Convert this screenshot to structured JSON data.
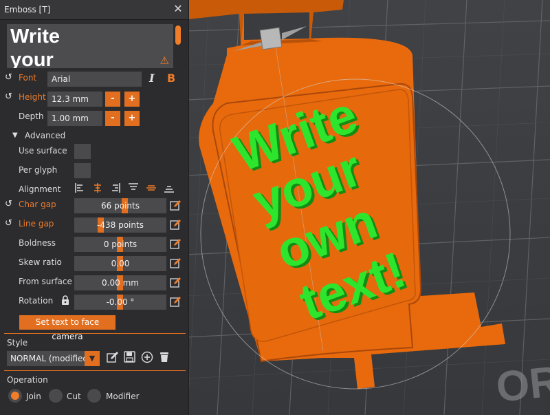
{
  "window": {
    "title": "Emboss [T]"
  },
  "text_editor": {
    "lines": [
      "Write",
      "your"
    ],
    "warning_icon": "warning-icon"
  },
  "font": {
    "label": "Font",
    "value": "Arial",
    "italic_icon": "italic-icon",
    "bold_label": "B"
  },
  "height": {
    "label": "Height",
    "value": "12.3 mm",
    "minus": "-",
    "plus": "+"
  },
  "depth": {
    "label": "Depth",
    "value": "1.00 mm",
    "minus": "-",
    "plus": "+"
  },
  "advanced": {
    "label": "Advanced",
    "expanded": true
  },
  "use_surface": {
    "label": "Use surface",
    "checked": false
  },
  "per_glyph": {
    "label": "Per glyph",
    "checked": false
  },
  "alignment": {
    "label": "Alignment",
    "options": [
      "align-left",
      "align-center",
      "align-right",
      "align-top",
      "align-middle",
      "align-bottom"
    ]
  },
  "char_gap": {
    "label": "Char gap",
    "value": "66 points"
  },
  "line_gap": {
    "label": "Line gap",
    "value": "-438 points"
  },
  "boldness": {
    "label": "Boldness",
    "value": "0 points"
  },
  "skew_ratio": {
    "label": "Skew ratio",
    "value": "0.00"
  },
  "from_surface": {
    "label": "From surface",
    "value": "0.00 mm"
  },
  "rotation": {
    "label": "Rotation",
    "value": "-0.00 °"
  },
  "camera_button": "Set text to face camera",
  "style": {
    "label": "Style",
    "selected": "NORMAL (modified)"
  },
  "operation": {
    "label": "Operation",
    "options": [
      "Join",
      "Cut",
      "Modifier"
    ],
    "selected": "Join"
  },
  "scene": {
    "embossed_lines": [
      "Write",
      "your",
      "own",
      "text!"
    ],
    "background_text": "OR"
  },
  "colors": {
    "accent": "#ef7d2a",
    "panel": "#2c2c2f",
    "emboss_green": "#2ee52e",
    "model_orange": "#e86a0d"
  }
}
